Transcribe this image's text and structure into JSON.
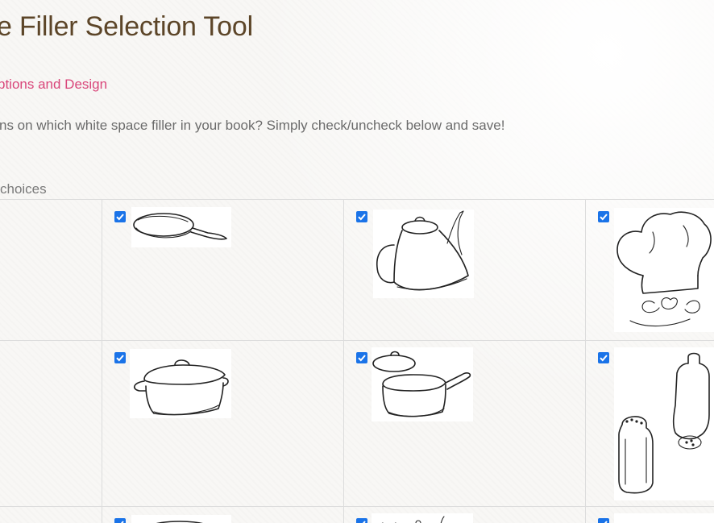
{
  "header": {
    "title": "e Filler Selection Tool"
  },
  "breadcrumb": {
    "link": "ptions and Design"
  },
  "intro": {
    "text": "ns on which white space filler in your book? Simply check/uncheck below and save!"
  },
  "choices": {
    "label": "choices"
  },
  "grid": {
    "rows": [
      {
        "cells": [
          {
            "icon": "frying-pan-icon",
            "checked": true
          },
          {
            "icon": "kettle-icon",
            "checked": true
          },
          {
            "icon": "chef-hat-icon",
            "checked": true
          }
        ]
      },
      {
        "cells": [
          {
            "icon": "casserole-pot-icon",
            "checked": true
          },
          {
            "icon": "saucepan-icon",
            "checked": true
          },
          {
            "icon": "salt-pepper-shakers-icon",
            "checked": true
          }
        ]
      },
      {
        "cells": [
          {
            "icon": "dish-icon",
            "checked": true
          },
          {
            "icon": "utensils-icon",
            "checked": true
          },
          {
            "icon": "kitchen-item-icon",
            "checked": true
          }
        ]
      }
    ]
  },
  "colors": {
    "title": "#5c4528",
    "link": "#d9467a",
    "checkbox": "#1a73e8",
    "text": "#6b6b6b",
    "grid_border": "#dcdcdc"
  }
}
